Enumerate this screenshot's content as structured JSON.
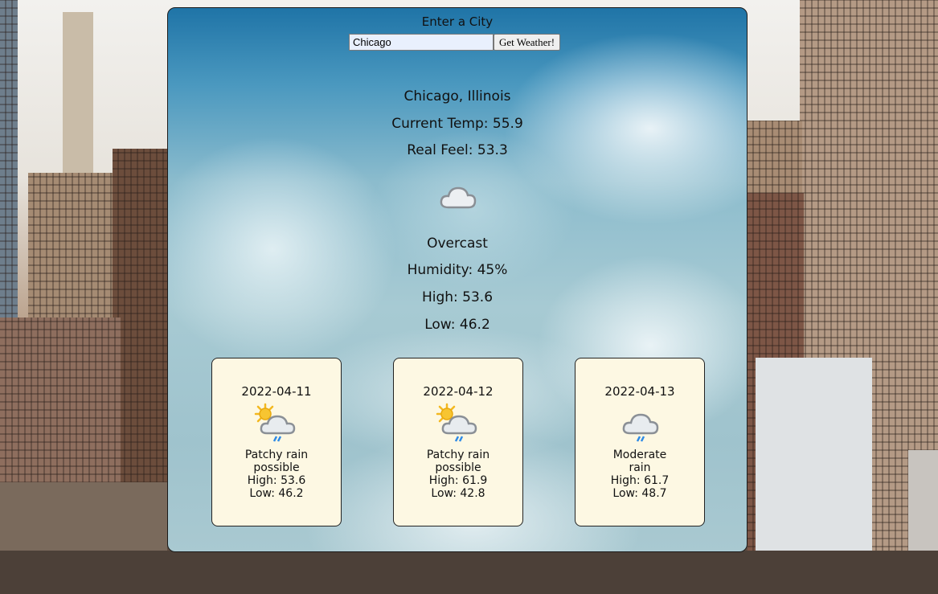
{
  "search": {
    "label": "Enter a City",
    "city_value": "Chicago",
    "button_label": "Get Weather!"
  },
  "current": {
    "location": "Chicago, Illinois",
    "temp": "Current Temp: 55.9",
    "real_feel": "Real Feel: 53.3",
    "icon": "cloud-icon",
    "condition": "Overcast",
    "humidity": "Humidity: 45%",
    "high": "High: 53.6",
    "low": "Low: 46.2"
  },
  "forecast": [
    {
      "date": "2022-04-11",
      "icon": "sun-cloud-rain-icon",
      "cond1": "Patchy rain",
      "cond2": "possible",
      "high": "High: 53.6",
      "low": "Low: 46.2"
    },
    {
      "date": "2022-04-12",
      "icon": "sun-cloud-rain-icon",
      "cond1": "Patchy rain",
      "cond2": "possible",
      "high": "High: 61.9",
      "low": "Low: 42.8"
    },
    {
      "date": "2022-04-13",
      "icon": "cloud-rain-icon",
      "cond1": "Moderate",
      "cond2": "rain",
      "high": "High: 61.7",
      "low": "Low: 48.7"
    }
  ],
  "colors": {
    "card_bg": "#fdf8e3",
    "panel_border": "#1b1b1b"
  }
}
